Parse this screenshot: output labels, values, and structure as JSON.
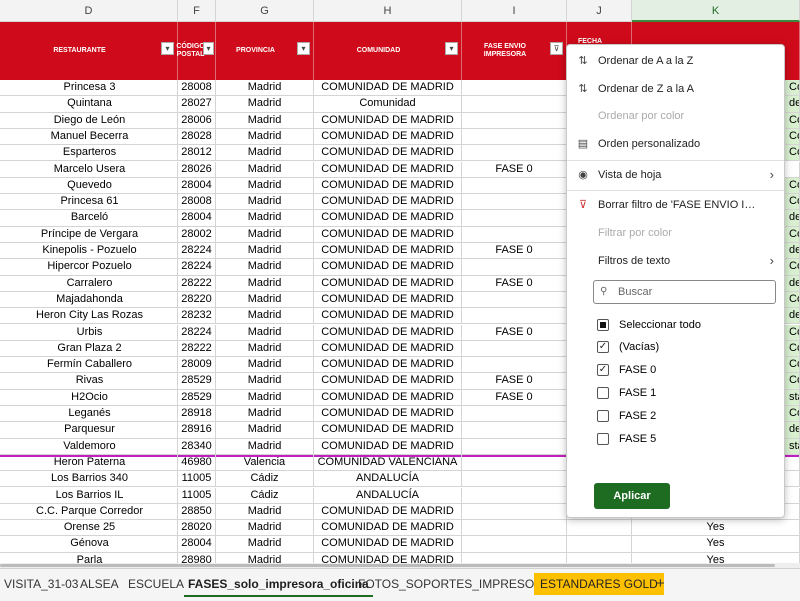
{
  "column_letters": [
    "D",
    "F",
    "G",
    "H",
    "I",
    "J",
    "K"
  ],
  "headers": {
    "restaurante": "RESTAURANTE",
    "codigo_postal": "CÓDIGO POSTAL",
    "provincia": "PROVINCIA",
    "comunidad": "COMUNIDAD",
    "fase": "FASE ENVIO IMPRESORA",
    "fecha": "FECHA ENVIO"
  },
  "rows": [
    {
      "r": "Princesa 3",
      "cp": "28008",
      "p": "Madrid",
      "c": "COMUNIDAD DE MADRID",
      "f": "",
      "k": "Co"
    },
    {
      "r": "Quintana",
      "cp": "28027",
      "p": "Madrid",
      "c": "Comunidad",
      "f": "",
      "k": "del"
    },
    {
      "r": "Diego de León",
      "cp": "28006",
      "p": "Madrid",
      "c": "COMUNIDAD DE MADRID",
      "f": "",
      "k": "Co"
    },
    {
      "r": "Manuel Becerra",
      "cp": "28028",
      "p": "Madrid",
      "c": "COMUNIDAD DE MADRID",
      "f": "",
      "k": "Co"
    },
    {
      "r": "Esparteros",
      "cp": "28012",
      "p": "Madrid",
      "c": "COMUNIDAD DE MADRID",
      "f": "",
      "k": "Co"
    },
    {
      "r": "Marcelo Usera",
      "cp": "28026",
      "p": "Madrid",
      "c": "COMUNIDAD DE MADRID",
      "f": "FASE 0",
      "k": ""
    },
    {
      "r": "Quevedo",
      "cp": "28004",
      "p": "Madrid",
      "c": "COMUNIDAD DE MADRID",
      "f": "",
      "k": "Co"
    },
    {
      "r": "Princesa 61",
      "cp": "28008",
      "p": "Madrid",
      "c": "COMUNIDAD DE MADRID",
      "f": "",
      "k": "Co"
    },
    {
      "r": "Barceló",
      "cp": "28004",
      "p": "Madrid",
      "c": "COMUNIDAD DE MADRID",
      "f": "",
      "k": "del"
    },
    {
      "r": "Príncipe de Vergara",
      "cp": "28002",
      "p": "Madrid",
      "c": "COMUNIDAD DE MADRID",
      "f": "",
      "k": "Co"
    },
    {
      "r": "Kinepolis - Pozuelo",
      "cp": "28224",
      "p": "Madrid",
      "c": "COMUNIDAD DE MADRID",
      "f": "FASE 0",
      "k": "del"
    },
    {
      "r": "Hipercor Pozuelo",
      "cp": "28224",
      "p": "Madrid",
      "c": "COMUNIDAD DE MADRID",
      "f": "",
      "k": "Co"
    },
    {
      "r": "Carralero",
      "cp": "28222",
      "p": "Madrid",
      "c": "COMUNIDAD DE MADRID",
      "f": "FASE 0",
      "k": "del"
    },
    {
      "r": "Majadahonda",
      "cp": "28220",
      "p": "Madrid",
      "c": "COMUNIDAD DE MADRID",
      "f": "",
      "k": "Co"
    },
    {
      "r": "Heron City Las Rozas",
      "cp": "28232",
      "p": "Madrid",
      "c": "COMUNIDAD DE MADRID",
      "f": "",
      "k": "del"
    },
    {
      "r": "Urbis",
      "cp": "28224",
      "p": "Madrid",
      "c": "COMUNIDAD DE MADRID",
      "f": "FASE 0",
      "k": "Co"
    },
    {
      "r": "Gran Plaza 2",
      "cp": "28222",
      "p": "Madrid",
      "c": "COMUNIDAD DE MADRID",
      "f": "",
      "k": "Co"
    },
    {
      "r": "Fermín Caballero",
      "cp": "28009",
      "p": "Madrid",
      "c": "COMUNIDAD DE MADRID",
      "f": "",
      "k": "Co"
    },
    {
      "r": "Rivas",
      "cp": "28529",
      "p": "Madrid",
      "c": "COMUNIDAD DE MADRID",
      "f": "FASE 0",
      "k": "Co"
    },
    {
      "r": "H2Ocio",
      "cp": "28529",
      "p": "Madrid",
      "c": "COMUNIDAD DE MADRID",
      "f": "FASE 0",
      "k": "sta"
    },
    {
      "r": "Leganés",
      "cp": "28918",
      "p": "Madrid",
      "c": "COMUNIDAD DE MADRID",
      "f": "",
      "k": "Co"
    },
    {
      "r": "Parquesur",
      "cp": "28916",
      "p": "Madrid",
      "c": "COMUNIDAD DE MADRID",
      "f": "",
      "k": "del"
    },
    {
      "r": "Valdemoro",
      "cp": "28340",
      "p": "Madrid",
      "c": "COMUNIDAD DE MADRID",
      "f": "",
      "k": "sta"
    },
    {
      "r": "Heron Paterna",
      "cp": "46980",
      "p": "Valencia",
      "c": "COMUNIDAD VALENCIANA",
      "f": "",
      "k": ""
    },
    {
      "r": "Los Barrios 340",
      "cp": "11005",
      "p": "Cádiz",
      "c": "ANDALUCÍA",
      "f": "",
      "k": ""
    },
    {
      "r": "Los Barrios IL",
      "cp": "11005",
      "p": "Cádiz",
      "c": "ANDALUCÍA",
      "f": "",
      "k": ""
    },
    {
      "r": "C.C. Parque Corredor",
      "cp": "28850",
      "p": "Madrid",
      "c": "COMUNIDAD DE MADRID",
      "f": "",
      "k": ""
    },
    {
      "r": "Orense 25",
      "cp": "28020",
      "p": "Madrid",
      "c": "COMUNIDAD DE MADRID",
      "f": "",
      "k": "Yes"
    },
    {
      "r": "Génova",
      "cp": "28004",
      "p": "Madrid",
      "c": "COMUNIDAD DE MADRID",
      "f": "",
      "k": "Yes"
    },
    {
      "r": "Parla",
      "cp": "28980",
      "p": "Madrid",
      "c": "COMUNIDAD DE MADRID",
      "f": "",
      "k": "Yes"
    }
  ],
  "menu": {
    "sort_az": "Ordenar de A a la Z",
    "sort_za": "Ordenar de Z a la A",
    "sort_color": "Ordenar por color",
    "custom_sort": "Orden personalizado",
    "sheet_view": "Vista de hoja",
    "clear_filter": "Borrar filtro de 'FASE ENVIO IMP...",
    "filter_color": "Filtrar por color",
    "text_filters": "Filtros de texto",
    "search_placeholder": "Buscar",
    "select_all": "Seleccionar todo",
    "options": [
      {
        "label": "(Vacías)",
        "checked": true
      },
      {
        "label": "FASE 0",
        "checked": true
      },
      {
        "label": "FASE 1",
        "checked": false
      },
      {
        "label": "FASE 2",
        "checked": false
      },
      {
        "label": "FASE 5",
        "checked": false
      }
    ],
    "apply": "Aplicar"
  },
  "tabs": [
    "VISITA_31-03",
    "ALSEA",
    "ESCUELA",
    "FASES_solo_impresora_oficina",
    "FOTOS_SOPORTES_IMPRESORAS",
    "ESTANDARES GOLD",
    "+"
  ],
  "active_tab": "FASES_solo_impresora_oficina",
  "accent": "#1e6b22",
  "header_color": "#cf0a1a",
  "gold_tab_color": "#ffc000"
}
